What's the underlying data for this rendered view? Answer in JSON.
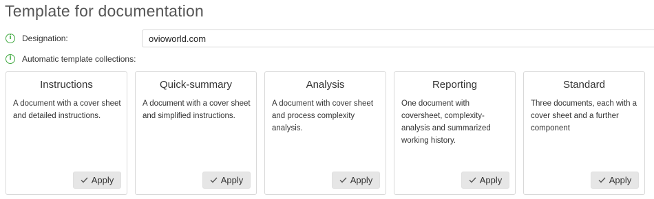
{
  "page": {
    "title": "Template for documentation"
  },
  "designation": {
    "label": "Designation:",
    "value": "ovioworld.com"
  },
  "collections": {
    "label": "Automatic template collections:",
    "cards": [
      {
        "title": "Instructions",
        "description": "A document with a cover sheet and detailed instructions.",
        "button_label": "Apply"
      },
      {
        "title": "Quick-summary",
        "description": "A document with a cover sheet and simplified instructions.",
        "button_label": "Apply"
      },
      {
        "title": "Analysis",
        "description": "A document with cover sheet and process complexity analysis.",
        "button_label": "Apply"
      },
      {
        "title": "Reporting",
        "description": "One document with coversheet, complexity-analysis and summarized working history.",
        "button_label": "Apply"
      },
      {
        "title": "Standard",
        "description": "Three documents, each with a cover sheet and a further component",
        "button_label": "Apply"
      }
    ]
  },
  "icons": {
    "info": "info-icon",
    "check": "checkmark-icon"
  },
  "colors": {
    "info_icon": "#3fa83f",
    "button_bg": "#e6e6e6",
    "card_border": "#d9d9d9"
  }
}
